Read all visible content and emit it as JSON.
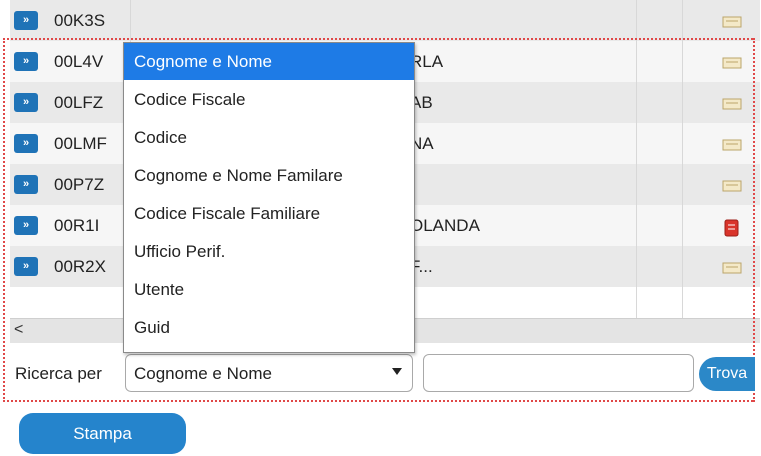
{
  "table": {
    "rows": [
      {
        "code": "00K3S",
        "name": "",
        "icon": "note-icon"
      },
      {
        "code": "00L4V",
        "name": "RLA",
        "icon": "note-icon"
      },
      {
        "code": "00LFZ",
        "name": "AB",
        "icon": "note-icon"
      },
      {
        "code": "00LMF",
        "name": "NA",
        "icon": "note-icon"
      },
      {
        "code": "00P7Z",
        "name": "",
        "icon": "note-icon"
      },
      {
        "code": "00R1I",
        "name": "OLANDA",
        "icon": "red-doc-icon"
      },
      {
        "code": "00R2X",
        "name": "F...",
        "icon": "note-icon"
      }
    ],
    "expand_label": "»"
  },
  "scrollbar": {
    "left_arrow": "<"
  },
  "search": {
    "label": "Ricerca per",
    "selected": "Cognome e Nome",
    "input_value": "",
    "find_label": "Trova",
    "options": [
      "Cognome e Nome",
      "Codice Fiscale",
      "Codice",
      "Cognome e Nome Familare",
      "Codice Fiscale Familiare",
      "Ufficio Perif.",
      "Utente",
      "Guid"
    ]
  },
  "print_label": "Stampa",
  "colors": {
    "accent": "#1f73b7",
    "highlight": "#1e7be6",
    "dotted_border": "#e04848",
    "red_icon": "#d9342b"
  }
}
